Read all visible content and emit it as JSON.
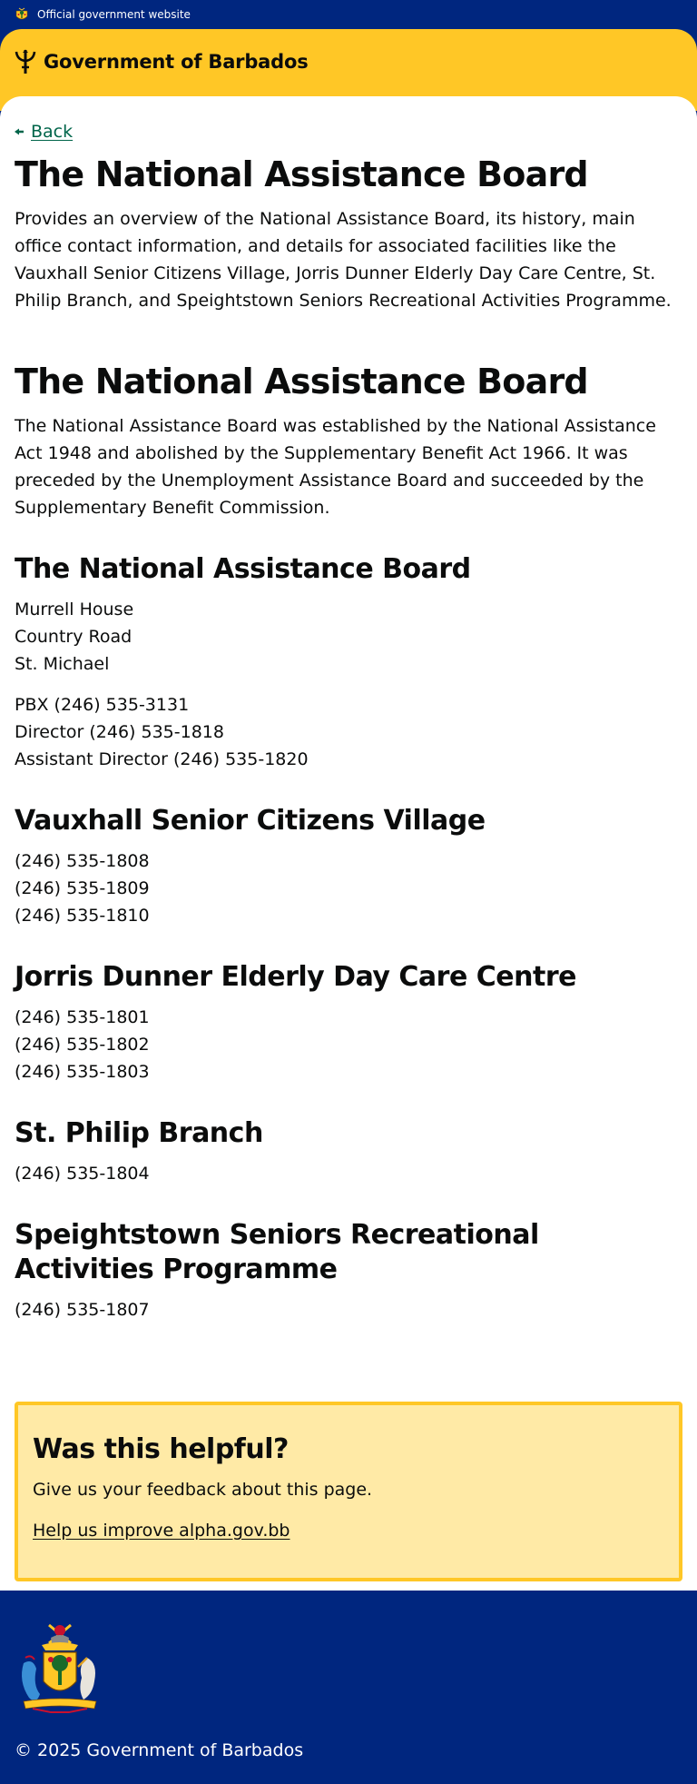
{
  "topbar": {
    "text": "Official government website",
    "icon": "barbados-crest-icon"
  },
  "header": {
    "site_title": "Government of Barbados",
    "icon": "trident-icon",
    "accent_color": "#ffc726"
  },
  "nav": {
    "back_label": "Back"
  },
  "page": {
    "title": "The National Assistance Board",
    "lede": "Provides an overview of the National Assistance Board, its history, main office contact information, and details for associated facilities like the Vauxhall Senior Citizens Village, Jorris Dunner Elderly Day Care Centre, St. Philip Branch, and Speightstown Seniors Recreational Activities Programme."
  },
  "content": {
    "heading": "The National Assistance Board",
    "intro": "The National Assistance Board was established by the National Assistance Act 1948 and abolished by the Supplementary Benefit Act 1966. It was preceded by the Unemployment Assistance Board and succeeded by the Supplementary Benefit Commission.",
    "sections": [
      {
        "heading": "The National Assistance Board",
        "address": [
          "Murrell House",
          "Country Road",
          "St. Michael"
        ],
        "phones": [
          "PBX (246) 535-3131",
          "Director (246) 535-1818",
          "Assistant Director (246) 535-1820"
        ]
      },
      {
        "heading": "Vauxhall Senior Citizens Village",
        "phones": [
          "(246) 535-1808",
          "(246) 535-1809",
          "(246) 535-1810"
        ]
      },
      {
        "heading": "Jorris Dunner Elderly Day Care Centre",
        "phones": [
          "(246) 535-1801",
          "(246) 535-1802",
          "(246) 535-1803"
        ]
      },
      {
        "heading": "St. Philip Branch",
        "phones": [
          "(246) 535-1804"
        ]
      },
      {
        "heading": "Speightstown Seniors Recreational Activities Programme",
        "phones": [
          "(246) 535-1807"
        ]
      }
    ]
  },
  "feedback": {
    "heading": "Was this helpful?",
    "text": "Give us your feedback about this page.",
    "link": "Help us improve alpha.gov.bb"
  },
  "footer": {
    "copyright": "© 2025 Government of Barbados",
    "icon": "barbados-coat-of-arms-icon"
  },
  "colors": {
    "brand_blue": "#00267f",
    "brand_yellow": "#ffc726",
    "feedback_bg": "#ffeaa6",
    "link_green": "#00654a"
  }
}
